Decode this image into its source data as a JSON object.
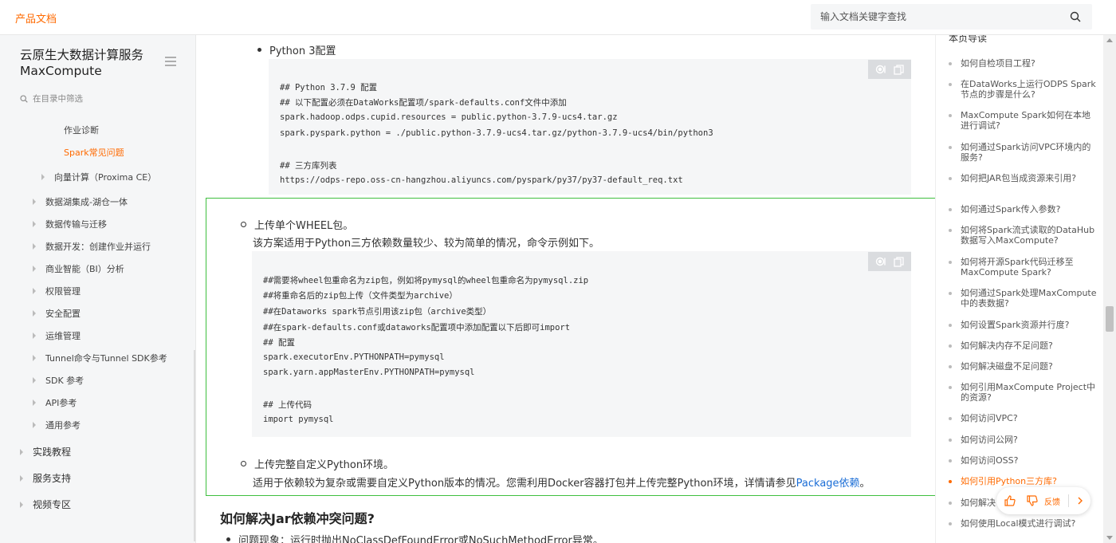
{
  "header": {
    "brand": "产品文档",
    "search_placeholder": "输入文档关键字查找"
  },
  "sidebar": {
    "product_title": "云原生大数据计算服务 MaxCompute",
    "filter_placeholder": "在目录中筛选",
    "items": [
      {
        "label": "作业诊断"
      },
      {
        "label": "Spark常见问题"
      },
      {
        "label": "向量计算（Proxima CE）"
      },
      {
        "label": "数据湖集成-湖仓一体"
      },
      {
        "label": "数据传输与迁移"
      },
      {
        "label": "数据开发：创建作业并运行"
      },
      {
        "label": "商业智能（BI）分析"
      },
      {
        "label": "权限管理"
      },
      {
        "label": "安全配置"
      },
      {
        "label": "运维管理"
      },
      {
        "label": "Tunnel命令与Tunnel SDK参考"
      },
      {
        "label": "SDK 参考"
      },
      {
        "label": "API参考"
      },
      {
        "label": "通用参考"
      },
      {
        "label": "实践教程"
      },
      {
        "label": "服务支持"
      },
      {
        "label": "视频专区"
      }
    ]
  },
  "main": {
    "python3_heading": "Python 3配置",
    "code1": [
      "## Python 3.7.9 配置",
      "## 以下配置必须在DataWorks配置项/spark-defaults.conf文件中添加",
      "spark.hadoop.odps.cupid.resources = public.python-3.7.9-ucs4.tar.gz",
      "spark.pyspark.python = ./public.python-3.7.9-ucs4.tar.gz/python-3.7.9-ucs4/bin/python3",
      "",
      "## 三方库列表",
      "https://odps-repo.oss-cn-hangzhou.aliyuncs.com/pyspark/py37/py37-default_req.txt"
    ],
    "wheel_title": "上传单个WHEEL包。",
    "wheel_desc": "该方案适用于Python三方依赖数量较少、较为简单的情况，命令示例如下。",
    "code2": [
      "##需要将wheel包重命名为zip包，例如将pymysql的wheel包重命名为pymysql.zip",
      "##将重命名后的zip包上传（文件类型为archive）",
      "##在Dataworks spark节点引用该zip包（archive类型）",
      "##在spark-defaults.conf或dataworks配置项中添加配置以下后即可import",
      "## 配置",
      "spark.executorEnv.PYTHONPATH=pymysql",
      "spark.yarn.appMasterEnv.PYTHONPATH=pymysql",
      "",
      "## 上传代码",
      "import pymysql"
    ],
    "env_title": "上传完整自定义Python环境。",
    "env_desc": "适用于依赖较为复杂或需要自定义Python版本的情况。您需利用Docker容器打包并上传完整Python环境，详情请参见",
    "env_link": "Package依赖",
    "env_tail": "。",
    "jar_heading": "如何解决Jar依赖冲突问题?",
    "jar_bullet": "问题现象：运行时抛出NoClassDefFoundError或NoSuchMethodError异常。"
  },
  "toc": {
    "heading": "本页导读",
    "items": [
      {
        "label": "如何自检项目工程?"
      },
      {
        "label": "在DataWorks上运行ODPS Spark节点的步骤是什么?"
      },
      {
        "label": "MaxCompute Spark如何在本地进行调试?"
      },
      {
        "label": "如何通过Spark访问VPC环境内的服务?"
      },
      {
        "label": "如何把JAR包当成资源来引用?"
      },
      {
        "label": "如何通过Spark传入参数?"
      },
      {
        "label": "如何将Spark流式读取的DataHub数据写入MaxCompute?"
      },
      {
        "label": "如何将开源Spark代码迁移至MaxCompute Spark?"
      },
      {
        "label": "如何通过Spark处理MaxCompute中的表数据?"
      },
      {
        "label": "如何设置Spark资源并行度?"
      },
      {
        "label": "如何解决内存不足问题?"
      },
      {
        "label": "如何解决磁盘不足问题?"
      },
      {
        "label": "如何引用MaxCompute Project中的资源?"
      },
      {
        "label": "如何访问VPC?"
      },
      {
        "label": "如何访问公网?"
      },
      {
        "label": "如何访问OSS?"
      },
      {
        "label": "如何引用Python三方库?"
      },
      {
        "label": "如何解决"
      },
      {
        "label": "如何使用Local模式进行调试?"
      }
    ],
    "feedback_label": "反馈"
  },
  "colors": {
    "accent": "#ff6a00",
    "link": "#1a6dd6",
    "highlight": "#3fbf3f"
  }
}
